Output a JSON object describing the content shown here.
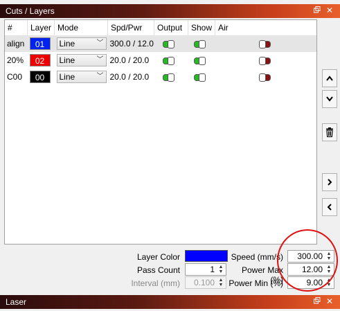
{
  "window": {
    "title": "Cuts / Layers",
    "bottom_title": "Laser"
  },
  "table": {
    "headers": [
      "#",
      "Layer",
      "Mode",
      "Spd/Pwr",
      "Output",
      "Show",
      "Air"
    ],
    "rows": [
      {
        "num": "align",
        "layer": "01",
        "layer_color": "#0022ee",
        "mode": "Line",
        "spd_pwr": "300.0 / 12.0",
        "output": true,
        "show": true,
        "air": false
      },
      {
        "num": "20%",
        "layer": "02",
        "layer_color": "#ee0000",
        "mode": "Line",
        "spd_pwr": "20.0 / 20.0",
        "output": true,
        "show": true,
        "air": false
      },
      {
        "num": "C00",
        "layer": "00",
        "layer_color": "#000000",
        "mode": "Line",
        "spd_pwr": "20.0 / 20.0",
        "output": true,
        "show": true,
        "air": false
      }
    ]
  },
  "settings": {
    "layer_color_label": "Layer Color",
    "layer_color": "#0000ff",
    "pass_count_label": "Pass Count",
    "pass_count": "1",
    "interval_label": "Interval (mm)",
    "interval": "0.100",
    "speed_label": "Speed (mm/s)",
    "speed": "300.00",
    "power_max_label": "Power Max (%)",
    "power_max": "12.00",
    "power_min_label": "Power Min (%)",
    "power_min": "9.00"
  },
  "icons": [
    "restore-icon",
    "close-icon",
    "chevron-up-icon",
    "chevron-down-icon",
    "trash-icon",
    "chevron-right-icon",
    "chevron-left-icon"
  ]
}
